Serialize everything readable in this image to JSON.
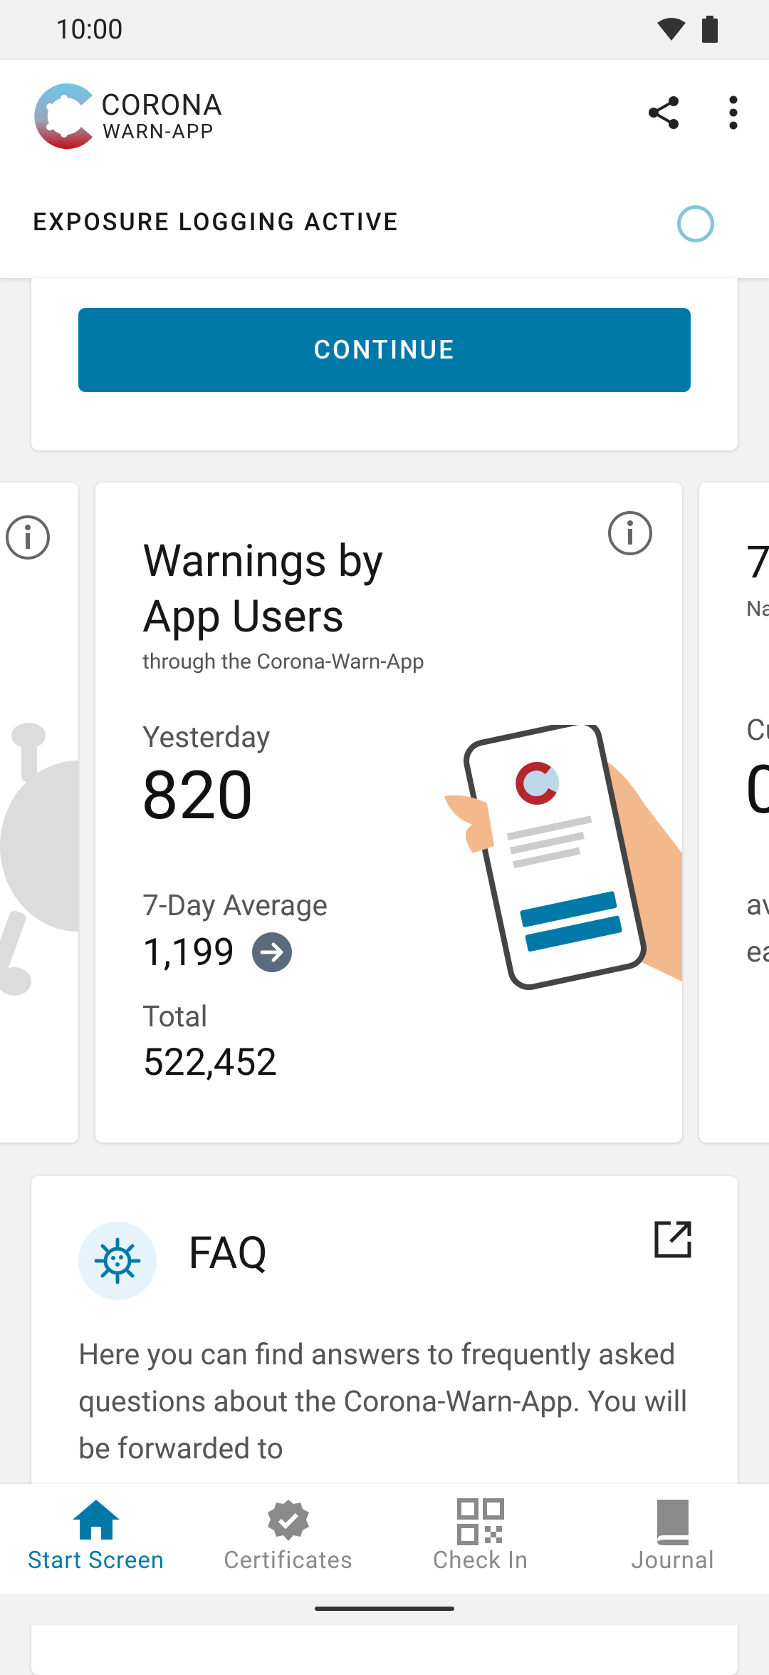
{
  "status_bar": {
    "time": "10:00"
  },
  "header": {
    "logo_line1": "CORONA",
    "logo_line2": "WARN-APP",
    "share_icon": "share-icon",
    "menu_icon": "more-vert-icon",
    "exposure_status": "EXPOSURE LOGGING ACTIVE"
  },
  "continue_card": {
    "button_label": "CONTINUE"
  },
  "warnings_card": {
    "title_line1": "Warnings by",
    "title_line2": "App Users",
    "subtitle": "through the Corona-Warn-App",
    "yesterday_label": "Yesterday",
    "yesterday_value": "820",
    "avg_label": "7-Day Average",
    "avg_value": "1,199",
    "total_label": "Total",
    "total_value": "522,452"
  },
  "right_card_partial": {
    "line1": "7",
    "line2": "Na",
    "line3": "Cu",
    "line4": "0",
    "line5": "av",
    "line6": "ea"
  },
  "faq": {
    "title": "FAQ",
    "body": "Here you can find answers to frequently asked questions about the Corona-Warn-App. You will be forwarded to"
  },
  "bottom_nav": [
    {
      "label": "Start Screen",
      "icon": "home-icon",
      "active": true
    },
    {
      "label": "Certificates",
      "icon": "certificate-icon",
      "active": false
    },
    {
      "label": "Check In",
      "icon": "qr-code-icon",
      "active": false
    },
    {
      "label": "Journal",
      "icon": "book-icon",
      "active": false
    }
  ],
  "colors": {
    "primary": "#0079a8",
    "exposure_ring": "#84c5de"
  }
}
